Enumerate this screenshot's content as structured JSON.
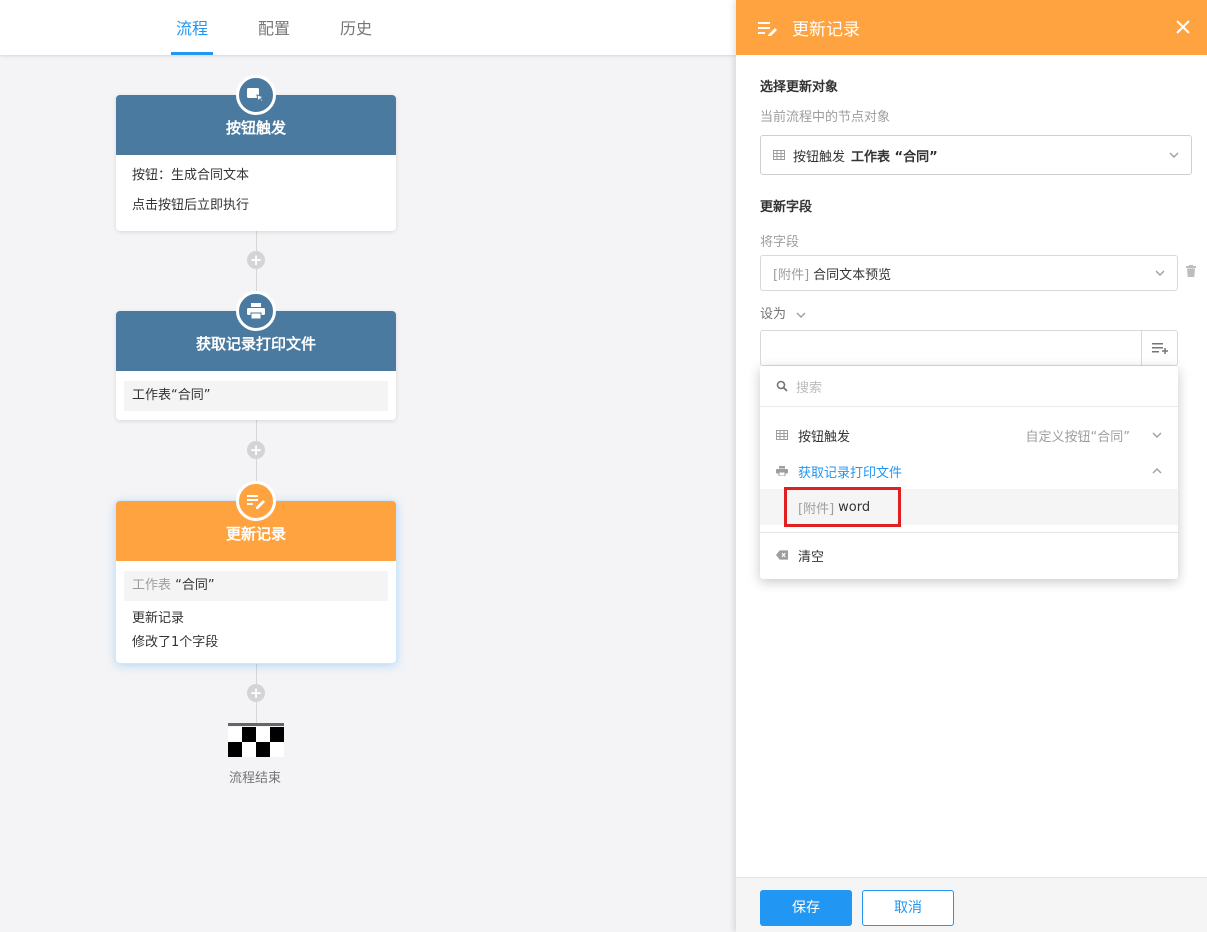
{
  "tabs": [
    {
      "label": "流程",
      "active": true
    },
    {
      "label": "配置",
      "active": false
    },
    {
      "label": "历史",
      "active": false
    }
  ],
  "flow": {
    "node1": {
      "title": "按钮触发",
      "line1": "按钮：生成合同文本",
      "line2": "点击按钮后立即执行",
      "icon": "cursor-click-icon"
    },
    "node2": {
      "title": "获取记录打印文件",
      "sheet": "工作表“合同”",
      "icon": "printer-icon"
    },
    "node3": {
      "title": "更新记录",
      "sheet_prefix": "工作表",
      "sheet_name": "“合同”",
      "line1": "更新记录",
      "line2": "修改了1个字段",
      "icon": "edit-list-icon"
    },
    "end_label": "流程结束"
  },
  "panel": {
    "title": "更新记录",
    "section1_title": "选择更新对象",
    "section1_sub": "当前流程中的节点对象",
    "target_node": "按钮触发",
    "target_sheet": "工作表 “合同”",
    "section2_title": "更新字段",
    "field_label": "将字段",
    "field_prefix": "[附件]",
    "field_name": "合同文本预览",
    "set_label": "设为",
    "set_value": "",
    "dropdown": {
      "search_placeholder": "搜索",
      "groups": [
        {
          "label": "按钮触发",
          "detail": "自定义按钮“合同”",
          "expanded": false
        },
        {
          "label": "获取记录打印文件",
          "detail": "",
          "expanded": true
        }
      ],
      "option_prefix": "[附件]",
      "option_name": "word",
      "clear_label": "清空"
    },
    "save_label": "保存",
    "cancel_label": "取消"
  },
  "colors": {
    "accent": "#2196f3",
    "orange": "#ffa340",
    "node_blue": "#4a7a9f",
    "highlight_red": "#e02020"
  }
}
